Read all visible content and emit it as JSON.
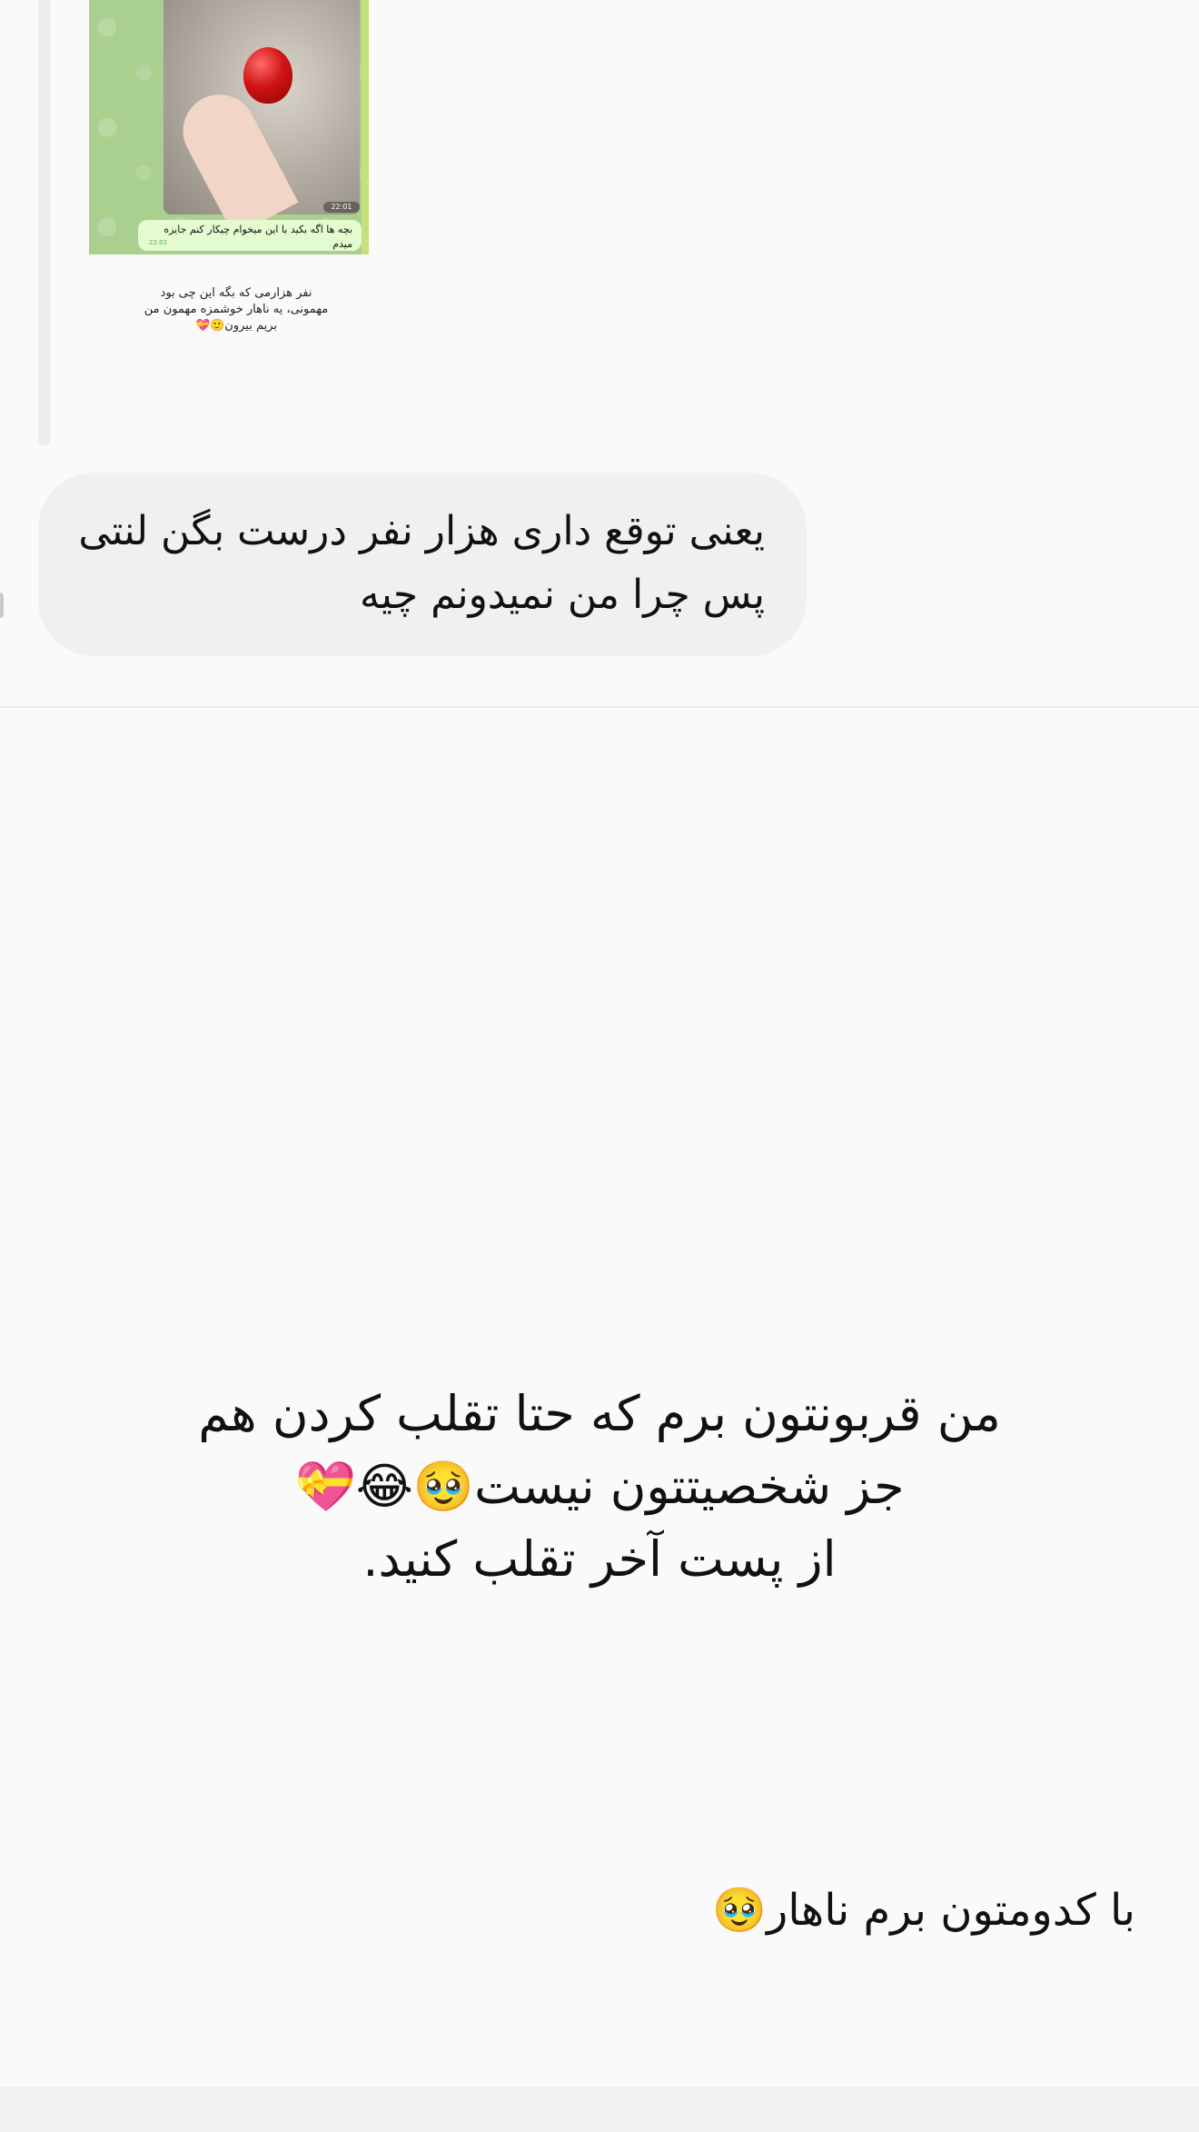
{
  "shared_post": {
    "image_caption_bubble": "بچه ها اگه بکید با این میخوام چیکار کنم جایزه میدم",
    "image_timestamp": "22:01",
    "caption_lines": [
      "نفر هزارمی که بگه این چی بود",
      "مهمونی، یه ناهار خوشمزه مهمون من",
      "بریم بیرون🙂💝"
    ]
  },
  "reply_message": {
    "lines": [
      "یعنی توقع داری هزار نفر درست بگن لنتی",
      "پس چرا من نمیدونم چیه"
    ]
  },
  "story": {
    "lines": [
      "من قربونتون برم که حتا تقلب کردن هم",
      "جز شخصیتتون نیست🥹😂💝",
      "از پست آخر تقلب کنید."
    ],
    "question": "با کدومتون برم ناهار🥹"
  }
}
